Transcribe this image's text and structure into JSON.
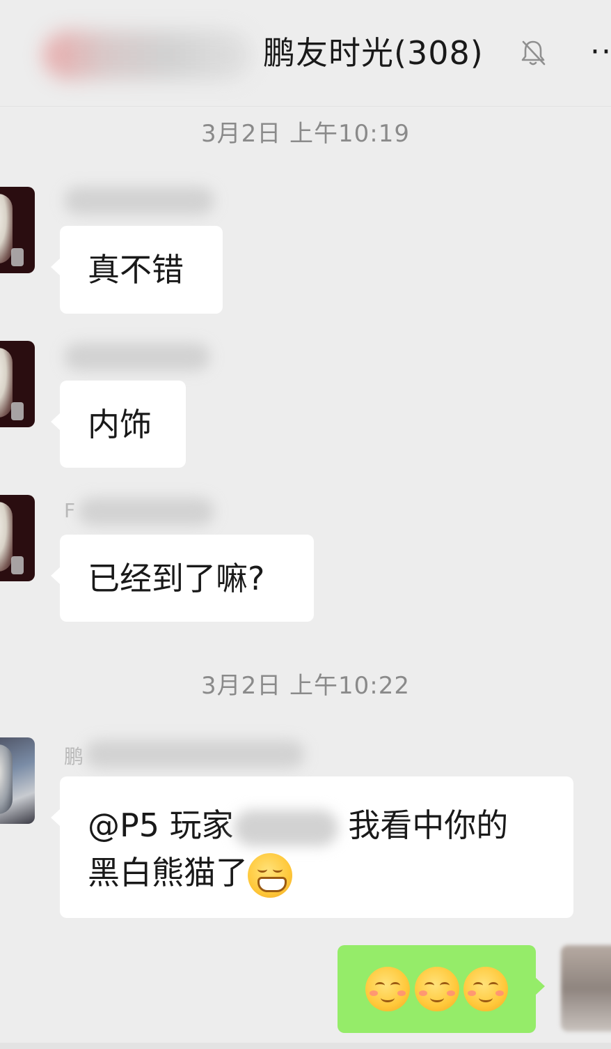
{
  "header": {
    "title": "鹏友时光(308)",
    "mute_icon": "bell-slash-icon",
    "more_icon": "more-dots-icon",
    "more_label": "··"
  },
  "messages": {
    "time1": "3月2日 上午10:19",
    "msg1": "真不错",
    "msg2": "内饰",
    "msg3_sender_fragment": "F",
    "msg3": "已经到了嘛?",
    "time2": "3月2日 上午10:22",
    "msg4_sender_fragment": "鹏",
    "msg4_line1_prefix": "@P5 玩家",
    "msg4_line1_suffix": "我看中你的",
    "msg4_line2": "黑白熊猫了",
    "msg4_emoji": "grinning-face-emoji",
    "my_msg_emojis": [
      "smiling-face-emoji",
      "smiling-face-emoji",
      "smiling-face-emoji"
    ]
  },
  "colors": {
    "background": "#ededed",
    "bubble_other": "#ffffff",
    "bubble_mine": "#95ec69",
    "timestamp": "#8a8a8a"
  }
}
